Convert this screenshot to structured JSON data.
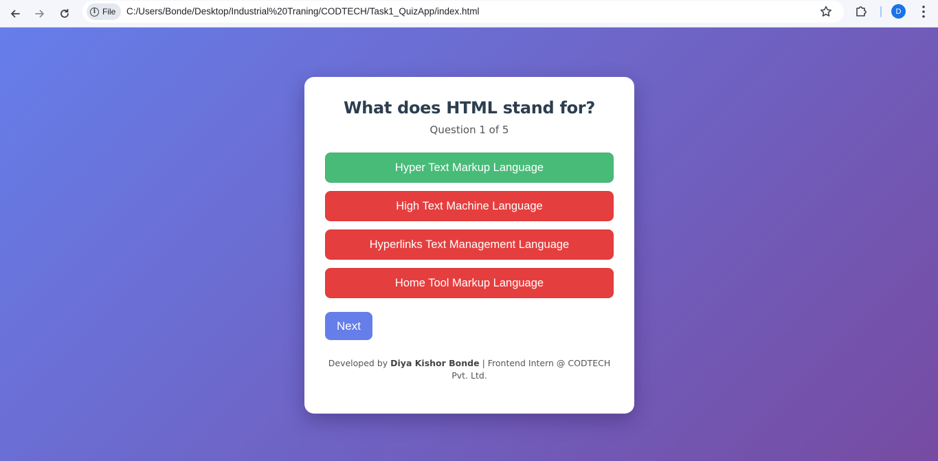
{
  "browser": {
    "chip_label": "File",
    "url": "C:/Users/Bonde/Desktop/Industrial%20Traning/CODTECH/Task1_QuizApp/index.html",
    "profile_initial": "D"
  },
  "quiz": {
    "question": "What does HTML stand for?",
    "progress": "Question 1 of 5",
    "options": [
      {
        "label": "Hyper Text Markup Language",
        "state": "correct",
        "color": "#48bb78"
      },
      {
        "label": "High Text Machine Language",
        "state": "wrong",
        "color": "#e53e3e"
      },
      {
        "label": "Hyperlinks Text Management Language",
        "state": "wrong",
        "color": "#e53e3e"
      },
      {
        "label": "Home Tool Markup Language",
        "state": "wrong",
        "color": "#e53e3e"
      }
    ],
    "next_label": "Next",
    "accent_color": "#667eea"
  },
  "footer": {
    "prefix": "Developed by ",
    "author": "Diya Kishor Bonde",
    "suffix": " | Frontend Intern @ CODTECH Pvt. Ltd."
  },
  "background": {
    "gradient_start": "#667eea",
    "gradient_end": "#764ba2"
  }
}
